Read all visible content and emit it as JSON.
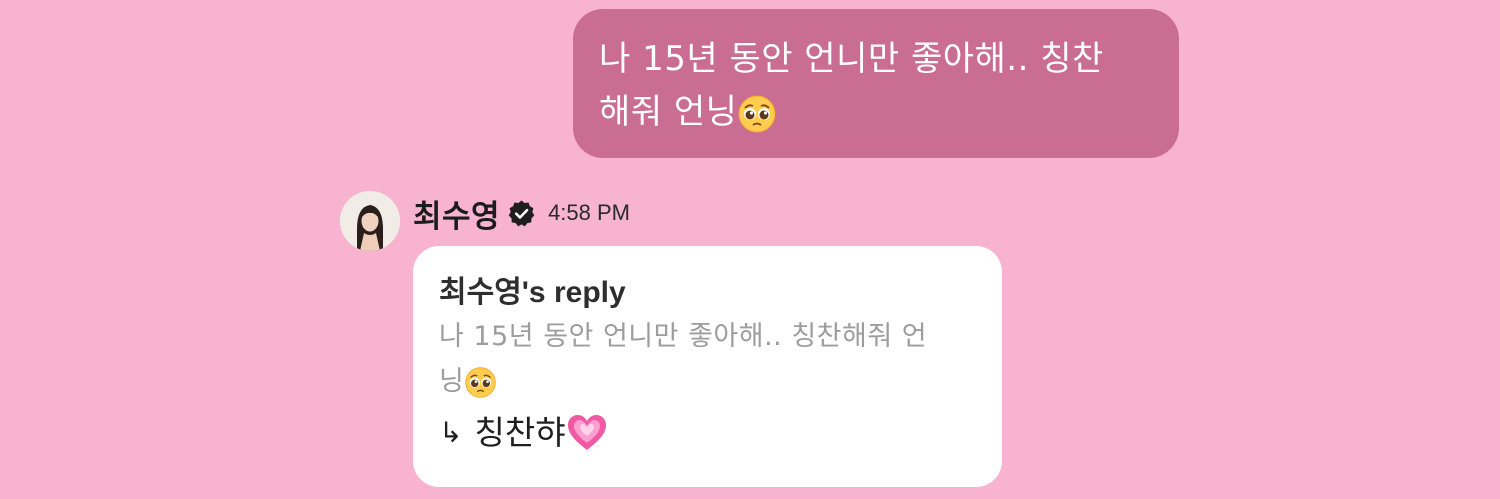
{
  "sent_message": {
    "line1": "나 15년 동안 언니만 좋아해.. 칭찬",
    "line2": "해줘 언닝",
    "emoji": "pleading-face-emoji"
  },
  "sender": {
    "name": "최수영",
    "verified_icon": "verified-badge-icon",
    "time": "4:58 PM"
  },
  "reply": {
    "title": "최수영's reply",
    "quoted_line1": "나 15년 동안 언니만 좋아해.. 칭찬해줘 언",
    "quoted_line2": "닝",
    "arrow": "↳",
    "text": "칭찬햐",
    "emoji": "pink-heart-emoji"
  },
  "colors": {
    "background": "#f7b3d0",
    "sent_bubble": "#c96d93",
    "reply_card": "#ffffff",
    "quoted_text": "#9d9d9d"
  }
}
